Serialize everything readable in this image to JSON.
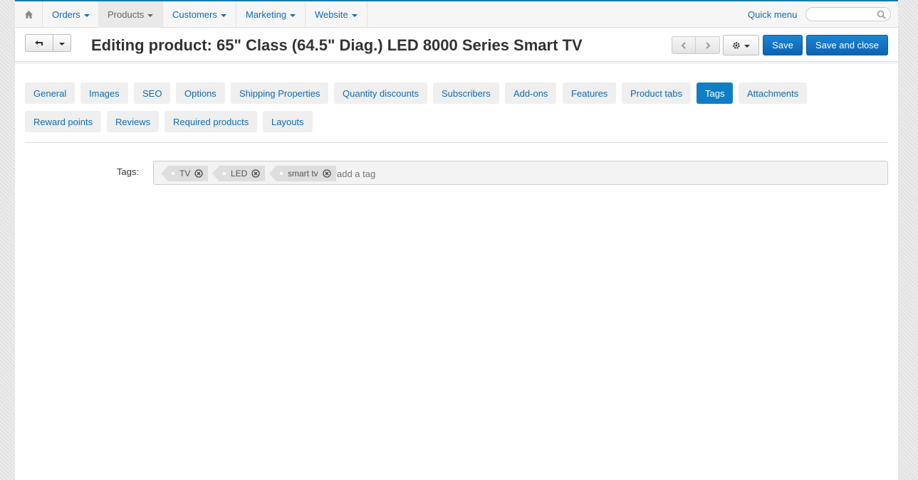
{
  "nav": {
    "home_icon": "home-icon",
    "items": [
      {
        "label": "Orders"
      },
      {
        "label": "Products"
      },
      {
        "label": "Customers"
      },
      {
        "label": "Marketing"
      },
      {
        "label": "Website"
      }
    ],
    "active": "Products",
    "quick_menu": "Quick menu",
    "search_placeholder": ""
  },
  "header": {
    "title": "Editing product: 65\" Class (64.5\" Diag.) LED 8000 Series Smart TV",
    "save_label": "Save",
    "save_close_label": "Save and close"
  },
  "tabs": [
    {
      "label": "General"
    },
    {
      "label": "Images"
    },
    {
      "label": "SEO"
    },
    {
      "label": "Options"
    },
    {
      "label": "Shipping Properties"
    },
    {
      "label": "Quantity discounts"
    },
    {
      "label": "Subscribers"
    },
    {
      "label": "Add-ons"
    },
    {
      "label": "Features"
    },
    {
      "label": "Product tabs"
    },
    {
      "label": "Tags"
    },
    {
      "label": "Attachments"
    },
    {
      "label": "Reward points"
    },
    {
      "label": "Reviews"
    },
    {
      "label": "Required products"
    },
    {
      "label": "Layouts"
    }
  ],
  "active_tab": "Tags",
  "tags_section": {
    "label": "Tags:",
    "tags": [
      {
        "label": "TV"
      },
      {
        "label": "LED"
      },
      {
        "label": "smart tv"
      }
    ],
    "input_placeholder": "add a tag"
  },
  "colors": {
    "accent": "#0e7fc5",
    "link": "#0e6cb3",
    "primary_button": "#0b63b3"
  }
}
